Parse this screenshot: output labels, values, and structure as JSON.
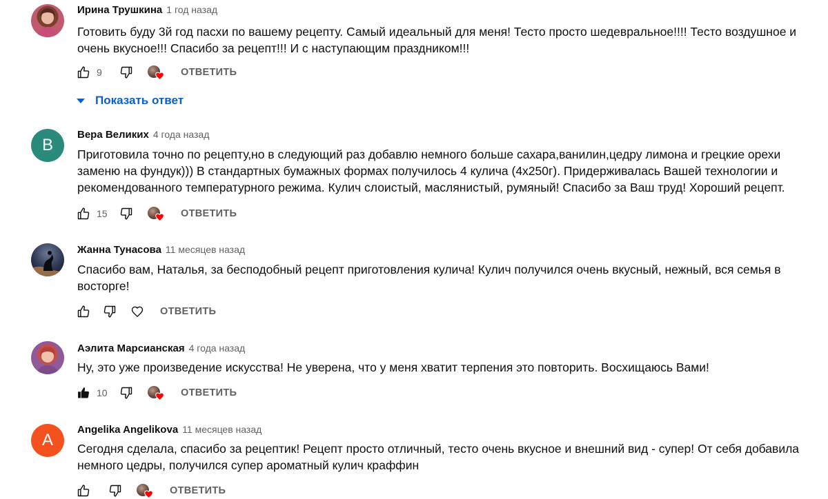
{
  "colors": {
    "link_blue": "#065fd4",
    "muted": "#606060",
    "heart_red": "#ff0000",
    "avatar_vera": "#2a8a7b",
    "avatar_angelika": "#f4511e"
  },
  "comments": [
    {
      "author": "Ирина Трушкина",
      "time": "1 год назад",
      "avatar": {
        "type": "photo",
        "icon": "user-photo"
      },
      "text": "Готовить буду  3й год пасхи по вашему рецепту. Самый идеальный для меня! Тесто просто шедевральное!!!! Тесто воздушное и очень вкусное!!! Спасибо за рецепт!!! И с наступающим праздником!!!",
      "likes": "9",
      "liked": false,
      "creator_heart": true,
      "reply_label": "ОТВЕТИТЬ",
      "show_replies": "Показать ответ"
    },
    {
      "author": "Вера Великих",
      "time": "4 года назад",
      "avatar": {
        "type": "letter",
        "letter": "В"
      },
      "text": "Приготовила точно по рецепту,но в следующий раз добавлю немного больше сахара,ванилин,цедру лимона и грецкие орехи заменю на фундук))) В стандартных бумажных формах получилось 4 кулича (4х250г). Придерживалась Вашей технологии и рекомендованного температурного режима. Кулич слоистый, маслянистый, румяный! Спасибо за Ваш труд! Хороший рецепт.",
      "likes": "15",
      "liked": false,
      "creator_heart": true,
      "reply_label": "ОТВЕТИТЬ"
    },
    {
      "author": "Жанна Тунасова",
      "time": "11 месяцев назад",
      "avatar": {
        "type": "photo",
        "icon": "user-photo"
      },
      "text": "Спасибо вам, Наталья, за бесподобный рецепт приготовления кулича! Кулич получился очень вкусный, нежный, вся семья в восторге!",
      "likes": "",
      "liked": false,
      "creator_heart": false,
      "reply_label": "ОТВЕТИТЬ"
    },
    {
      "author": "Аэлита Марсианская",
      "time": "4 года назад",
      "avatar": {
        "type": "photo",
        "icon": "user-photo"
      },
      "text": "Ну, это уже произведение искусства! Не уверена, что у меня хватит терпения это повторить. Восхищаюсь Вами!",
      "likes": "10",
      "liked": true,
      "creator_heart": true,
      "reply_label": "ОТВЕТИТЬ"
    },
    {
      "author": "Angelika Angelikova",
      "time": "11 месяцев назад",
      "avatar": {
        "type": "letter",
        "letter": "A"
      },
      "text": "Сегодня сделала, спасибо за рецептик! Рецепт просто отличный, тесто очень вкусное и внешний вид - супер! От себя добавила немного цедры, получился супер ароматный кулич краффин",
      "likes": "",
      "liked": false,
      "creator_heart": true,
      "reply_label": "ОТВЕТИТЬ"
    }
  ]
}
